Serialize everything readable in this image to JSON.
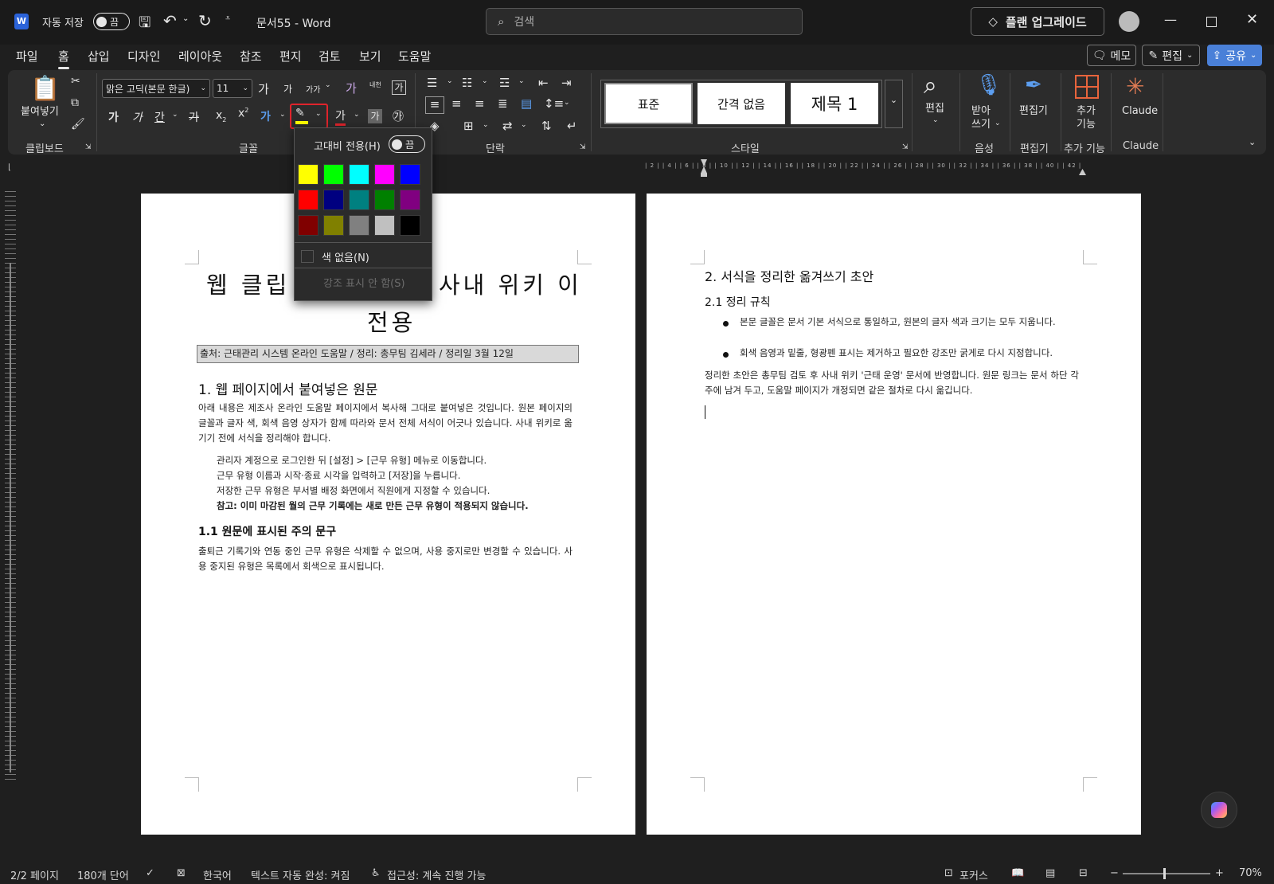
{
  "titlebar": {
    "autosave_label": "자동 저장",
    "autosave_state": "끔",
    "doc_title": "문서55  -  Word",
    "search_placeholder": "검색",
    "upgrade_label": "플랜 업그레이드"
  },
  "menu": {
    "tabs": [
      "파일",
      "홈",
      "삽입",
      "디자인",
      "레이아웃",
      "참조",
      "편지",
      "검토",
      "보기",
      "도움말"
    ],
    "active": "홈",
    "memo": "메모",
    "edit": "편집",
    "share": "공유"
  },
  "ribbon": {
    "clipboard": {
      "paste": "붙여넣기",
      "label": "클립보드"
    },
    "font": {
      "name": "맑은 고딕(본문 한글)",
      "size": "11",
      "label": "글꼴",
      "grow": "가",
      "shrink": "가",
      "case": "가가",
      "clear": "가",
      "phonetic": "내천",
      "border_char": "가",
      "bold": "가",
      "italic": "가",
      "underline": "간",
      "strike": "가",
      "sub": "x",
      "sup": "x",
      "font_color": "가",
      "shade": "가",
      "enclose": "㉮"
    },
    "paragraph": {
      "label": "단락"
    },
    "styles": {
      "items": [
        "표준",
        "간격 없음",
        "제목 1"
      ],
      "label": "스타일"
    },
    "editing": {
      "label": "편집"
    },
    "voice": {
      "dictate": "받아\n쓰기",
      "label": "음성"
    },
    "editor": {
      "button": "편집기",
      "label": "편집기"
    },
    "addins": {
      "button": "추가\n기능",
      "label": "추가 기능"
    },
    "claude": {
      "button": "Claude",
      "label": "Claude"
    }
  },
  "highlight_menu": {
    "high_contrast": "고대비 전용(H)",
    "toggle_state": "끔",
    "colors": [
      "#ffff00",
      "#00ff00",
      "#00ffff",
      "#ff00ff",
      "#0000ff",
      "#ff0000",
      "#000080",
      "#008080",
      "#008000",
      "#800080",
      "#800000",
      "#808000",
      "#808080",
      "#c0c0c0",
      "#000000"
    ],
    "no_color": "색 없음(N)",
    "stop": "강조 표시 안 함(S)"
  },
  "ruler": {
    "marks": "| 2 | | 4 | | 6 | | 8 | | 10 | | 12 | | 14 | | 16 | | 18 | | 20 | | 22 | | 24 | | 26 | | 28 | | 30 | | 32 | | 34 | | 36 | | 38 | | 40 | | 42 |"
  },
  "page1": {
    "title_left": "웹 클립",
    "title_right": "사내 위키 이",
    "title_line2": "전용",
    "source": "출처: 근태관리 시스템 온라인 도움말 / 정리: 총무팀 김세라 / 정리일 3월 12일",
    "h1": "1. 웹 페이지에서 붙여넣은 원문",
    "p1": "아래 내용은 제조사 온라인 도움말 페이지에서 복사해 그대로 붙여넣은 것입니다. 원본 페이지의 글꼴과 글자 색, 회색 음영 상자가 함께 따라와 문서 전체 서식이 어긋나 있습니다. 사내 위키로 옮기기 전에 서식을 정리해야 합니다.",
    "steps": [
      "관리자 계정으로 로그인한 뒤 [설정] > [근무 유형] 메뉴로 이동합니다.",
      "근무 유형 이름과 시작·종료 시각을 입력하고 [저장]을 누릅니다.",
      "저장한 근무 유형은 부서별 배정 화면에서 직원에게 지정할 수 있습니다."
    ],
    "note": "참고: 이미 마감된 월의 근무 기록에는 새로 만든 근무 유형이 적용되지 않습니다.",
    "h2": "1.1 원문에 표시된 주의 문구",
    "p2": "출퇴근 기록기와 연동 중인 근무 유형은 삭제할 수 없으며, 사용 중지로만 변경할 수 있습니다. 사용 중지된 유형은 목록에서 회색으로 표시됩니다."
  },
  "page2": {
    "h1": "2. 서식을 정리한 옮겨쓰기 초안",
    "h2": "2.1 정리 규칙",
    "bullets": [
      "본문 글꼴은 문서 기본 서식으로 통일하고, 원본의 글자 색과 크기는 모두 지웁니다.",
      "회색 음영과 밑줄, 형광펜 표시는 제거하고 필요한 강조만 굵게로 다시 지정합니다."
    ],
    "p": "정리한 초안은 총무팀 검토 후 사내 위키 '근태 운영' 문서에 반영합니다. 원문 링크는 문서 하단 각주에 남겨 두고, 도움말 페이지가 개정되면 같은 절차로 다시 옮깁니다."
  },
  "status": {
    "page": "2/2 페이지",
    "words": "180개 단어",
    "language": "한국어",
    "autocomplete": "텍스트 자동 완성: 켜짐",
    "accessibility": "접근성: 계속 진행 가능",
    "focus": "포커스",
    "zoom": "70%"
  }
}
